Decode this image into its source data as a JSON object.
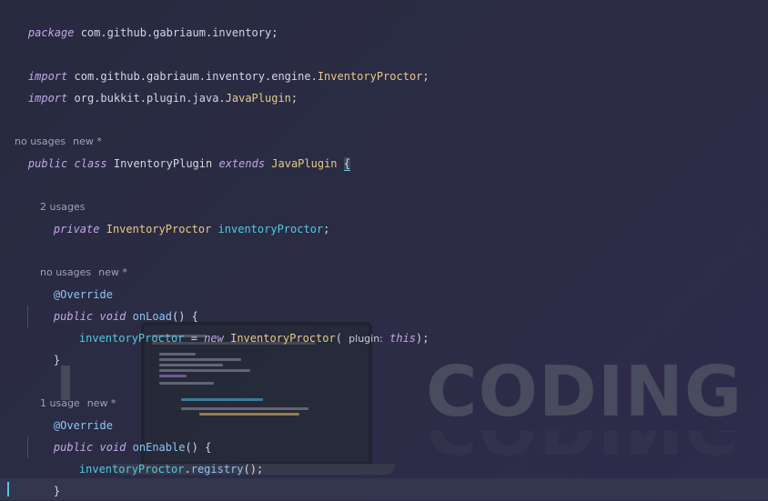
{
  "watermark": {
    "text": "CODING"
  },
  "lines": {
    "l1": {
      "kw": "package",
      "rest": " com.github.gabriaum.inventory;"
    },
    "l2": {
      "kw": "import",
      "pkg": " com.github.gabriaum.inventory.engine.",
      "cls": "InventoryProctor",
      "end": ";"
    },
    "l3": {
      "kw": "import",
      "pkg": " org.bukkit.plugin.java.",
      "cls": "JavaPlugin",
      "end": ";"
    },
    "h1": {
      "usages": "no usages",
      "new": "new *"
    },
    "l4": {
      "kw1": "public",
      "kw2": "class",
      "name": "InventoryPlugin",
      "kw3": "extends",
      "cls": "JavaPlugin",
      "brace": "{"
    },
    "h2": {
      "usages": "2 usages"
    },
    "l5": {
      "kw": "private",
      "cls": "InventoryProctor",
      "field": "inventoryProctor",
      "end": ";"
    },
    "h3": {
      "usages": "no usages",
      "new": "new *"
    },
    "l6": {
      "ann": "@Override"
    },
    "l7": {
      "kw1": "public",
      "kw2": "void",
      "fn": "onLoad",
      "rest": "() {"
    },
    "l8": {
      "field": "inventoryProctor",
      "op": " = ",
      "kw": "new",
      "cls": "InventoryProctor",
      "open": "( ",
      "hint": "plugin:",
      "this": "this",
      "end": ");"
    },
    "l9": {
      "text": "}"
    },
    "h4": {
      "usages": "1 usage",
      "new": "new *"
    },
    "l10": {
      "ann": "@Override"
    },
    "l11": {
      "kw1": "public",
      "kw2": "void",
      "fn": "onEnable",
      "rest": "() {"
    },
    "l12": {
      "field": "inventoryProctor",
      "dot": ".",
      "fn": "registry",
      "end": "();"
    },
    "l13": {
      "text": "}"
    },
    "l14": {
      "text": "}"
    }
  }
}
